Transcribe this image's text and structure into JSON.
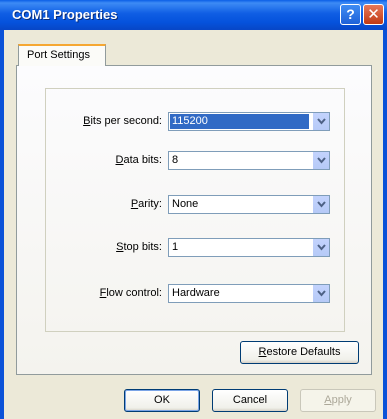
{
  "window": {
    "title": "COM1 Properties"
  },
  "title_buttons": {
    "help": "?",
    "close": "✕"
  },
  "tabs": [
    {
      "label": "Port Settings"
    }
  ],
  "fields": [
    {
      "mnemonic": "B",
      "rest": "its per second:",
      "value": "115200",
      "selected": true
    },
    {
      "mnemonic": "D",
      "rest": "ata bits:",
      "value": "8"
    },
    {
      "mnemonic": "P",
      "rest": "arity:",
      "value": "None"
    },
    {
      "mnemonic": "S",
      "rest": "top bits:",
      "value": "1"
    },
    {
      "mnemonic": "F",
      "rest": "low control:",
      "value": "Hardware"
    }
  ],
  "buttons": {
    "restore": {
      "mnemonic": "R",
      "rest": "estore Defaults"
    },
    "ok": "OK",
    "cancel": "Cancel",
    "apply": {
      "mnemonic": "A",
      "rest": "pply"
    }
  },
  "icons": {
    "dropdown": "chevron-down-icon"
  },
  "colors": {
    "title_bar": "#0552dc",
    "selection": "#316ac5",
    "tab_accent": "#f5a732"
  }
}
